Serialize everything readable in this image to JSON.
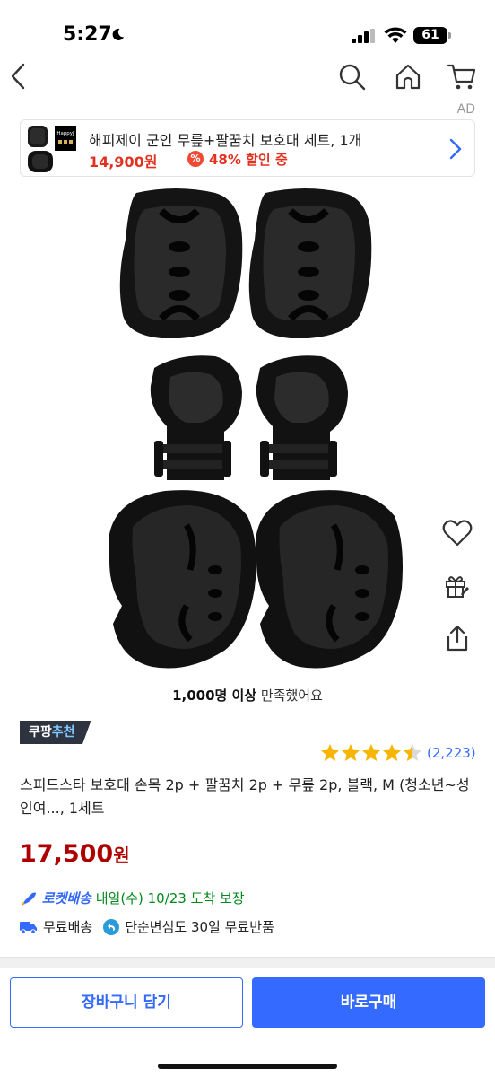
{
  "status_bar": {
    "time": "5:27",
    "battery": "61"
  },
  "nav": {
    "back_icon": "chevron-left-icon",
    "search_icon": "search-icon",
    "home_icon": "home-icon",
    "cart_icon": "cart-icon"
  },
  "ad": {
    "label": "AD",
    "title": "해피제이 군인 무릎+팔꿈치 보호대 세트, 1개",
    "price": "14,900원",
    "discount": "48% 할인 중",
    "thumb_text": "HappyJ"
  },
  "actions": {
    "like_icon": "heart-icon",
    "gift_icon": "gift-icon",
    "share_icon": "share-icon"
  },
  "satisfaction": {
    "count": "1,000명 이상",
    "suffix": " 만족했어요"
  },
  "badge": {
    "part1": "쿠팡",
    "part2": "추천"
  },
  "rating": {
    "stars": 4.5,
    "reviews": "(2,223)"
  },
  "product": {
    "title": "스피드스타 보호대 손목 2p + 팔꿈치 2p + 무릎 2p, 블랙, M (청소년~성인여..., 1세트",
    "price": "17,500",
    "currency": "원"
  },
  "delivery": {
    "rocket": "로켓배송",
    "arrival": " 내일(수) 10/23 도착 보장"
  },
  "shipping": {
    "free": "무료배송",
    "returns": "단순변심도 30일 무료반품"
  },
  "buttons": {
    "cart": "장바구니 담기",
    "buy": "바로구매"
  },
  "colors": {
    "accent": "#346aff",
    "price": "#ae0000",
    "green": "#00891a"
  }
}
